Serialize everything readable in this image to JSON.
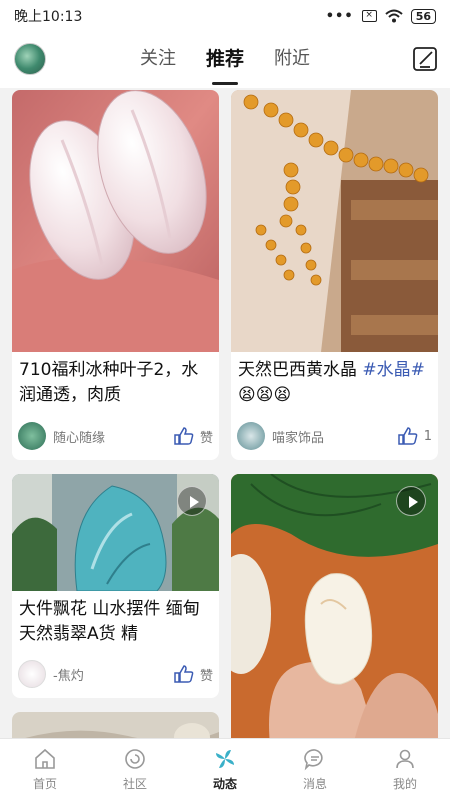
{
  "status_bar": {
    "time": "晚上10:13",
    "signal_dots": "•••",
    "battery": "56"
  },
  "header": {
    "tabs": [
      {
        "label": "关注",
        "active": false
      },
      {
        "label": "推荐",
        "active": true
      },
      {
        "label": "附近",
        "active": false
      }
    ]
  },
  "feed": {
    "cards": [
      {
        "title": "710福利冰种叶子2，水润通透，肉质",
        "user": "随心随缘",
        "likes": "赞",
        "image": "clear-leaf-carving-photo"
      },
      {
        "title_text": "天然巴西黄水晶 ",
        "title_tag": "#水晶#",
        "title_emoji": " 😫😫😫",
        "user": "喵家饰品",
        "likes": "1",
        "image": "citrine-bead-bracelet-photo"
      },
      {
        "title": "大件飘花 山水摆件 缅甸天然翡翠A货 精",
        "user": "-焦灼",
        "likes": "赞",
        "image": "jade-mountain-carving-photo",
        "video": true
      },
      {
        "image": "white-jade-pebble-photo",
        "video": true
      }
    ]
  },
  "bottom_nav": {
    "items": [
      {
        "label": "首页",
        "icon": "home-icon",
        "active": false
      },
      {
        "label": "社区",
        "icon": "community-icon",
        "active": false
      },
      {
        "label": "动态",
        "icon": "pinwheel-icon",
        "active": true
      },
      {
        "label": "消息",
        "icon": "message-icon",
        "active": false
      },
      {
        "label": "我的",
        "icon": "profile-icon",
        "active": false
      }
    ]
  },
  "colors": {
    "accent": "#3ab0c8",
    "tag": "#3b5bb3",
    "background": "#f2f2f2"
  }
}
